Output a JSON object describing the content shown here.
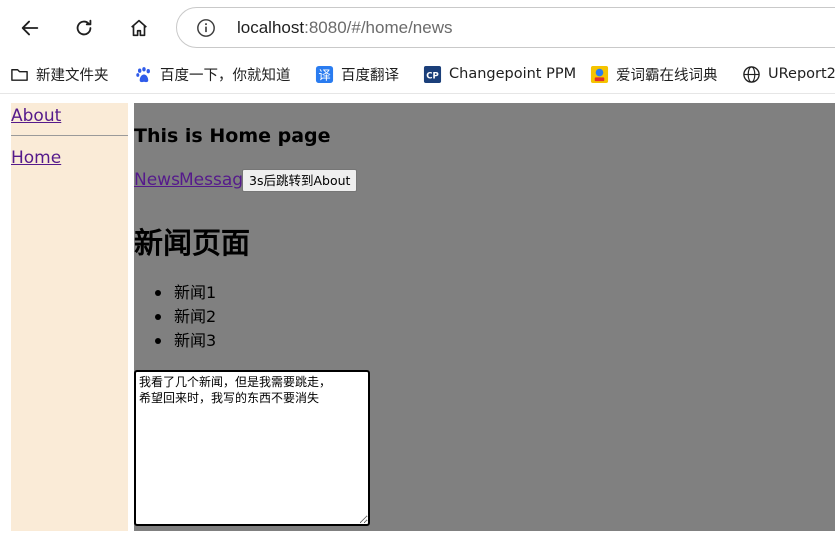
{
  "browser": {
    "url_host": "localhost",
    "url_rest": ":8080/#/home/news",
    "bookmarks": [
      {
        "label": "新建文件夹",
        "icon": "folder-icon"
      },
      {
        "label": "百度一下，你就知道",
        "icon": "baidu-paw-icon"
      },
      {
        "label": "百度翻译",
        "icon": "baidu-translate-icon"
      },
      {
        "label": "Changepoint PPM",
        "icon": "changepoint-icon"
      },
      {
        "label": "爱词霸在线词典",
        "icon": "iciba-icon"
      },
      {
        "label": "UReport2",
        "icon": "globe-icon"
      }
    ]
  },
  "sidebar": {
    "items": [
      {
        "label": "About"
      },
      {
        "label": "Home"
      }
    ]
  },
  "main": {
    "home_title": "This is Home page",
    "subnav": [
      {
        "label": "News"
      },
      {
        "label": "Message"
      }
    ],
    "redirect_button": "3s后跳转到About",
    "news_title": "新闻页面",
    "news_items": [
      "新闻1",
      "新闻2",
      "新闻3"
    ],
    "note_text": "我看了几个新闻，但是我需要跳走，\n希望回来时，我写的东西不要消失"
  },
  "colors": {
    "sidebar_bg": "#faebd7",
    "main_bg": "#808080",
    "link": "#551a8b"
  }
}
